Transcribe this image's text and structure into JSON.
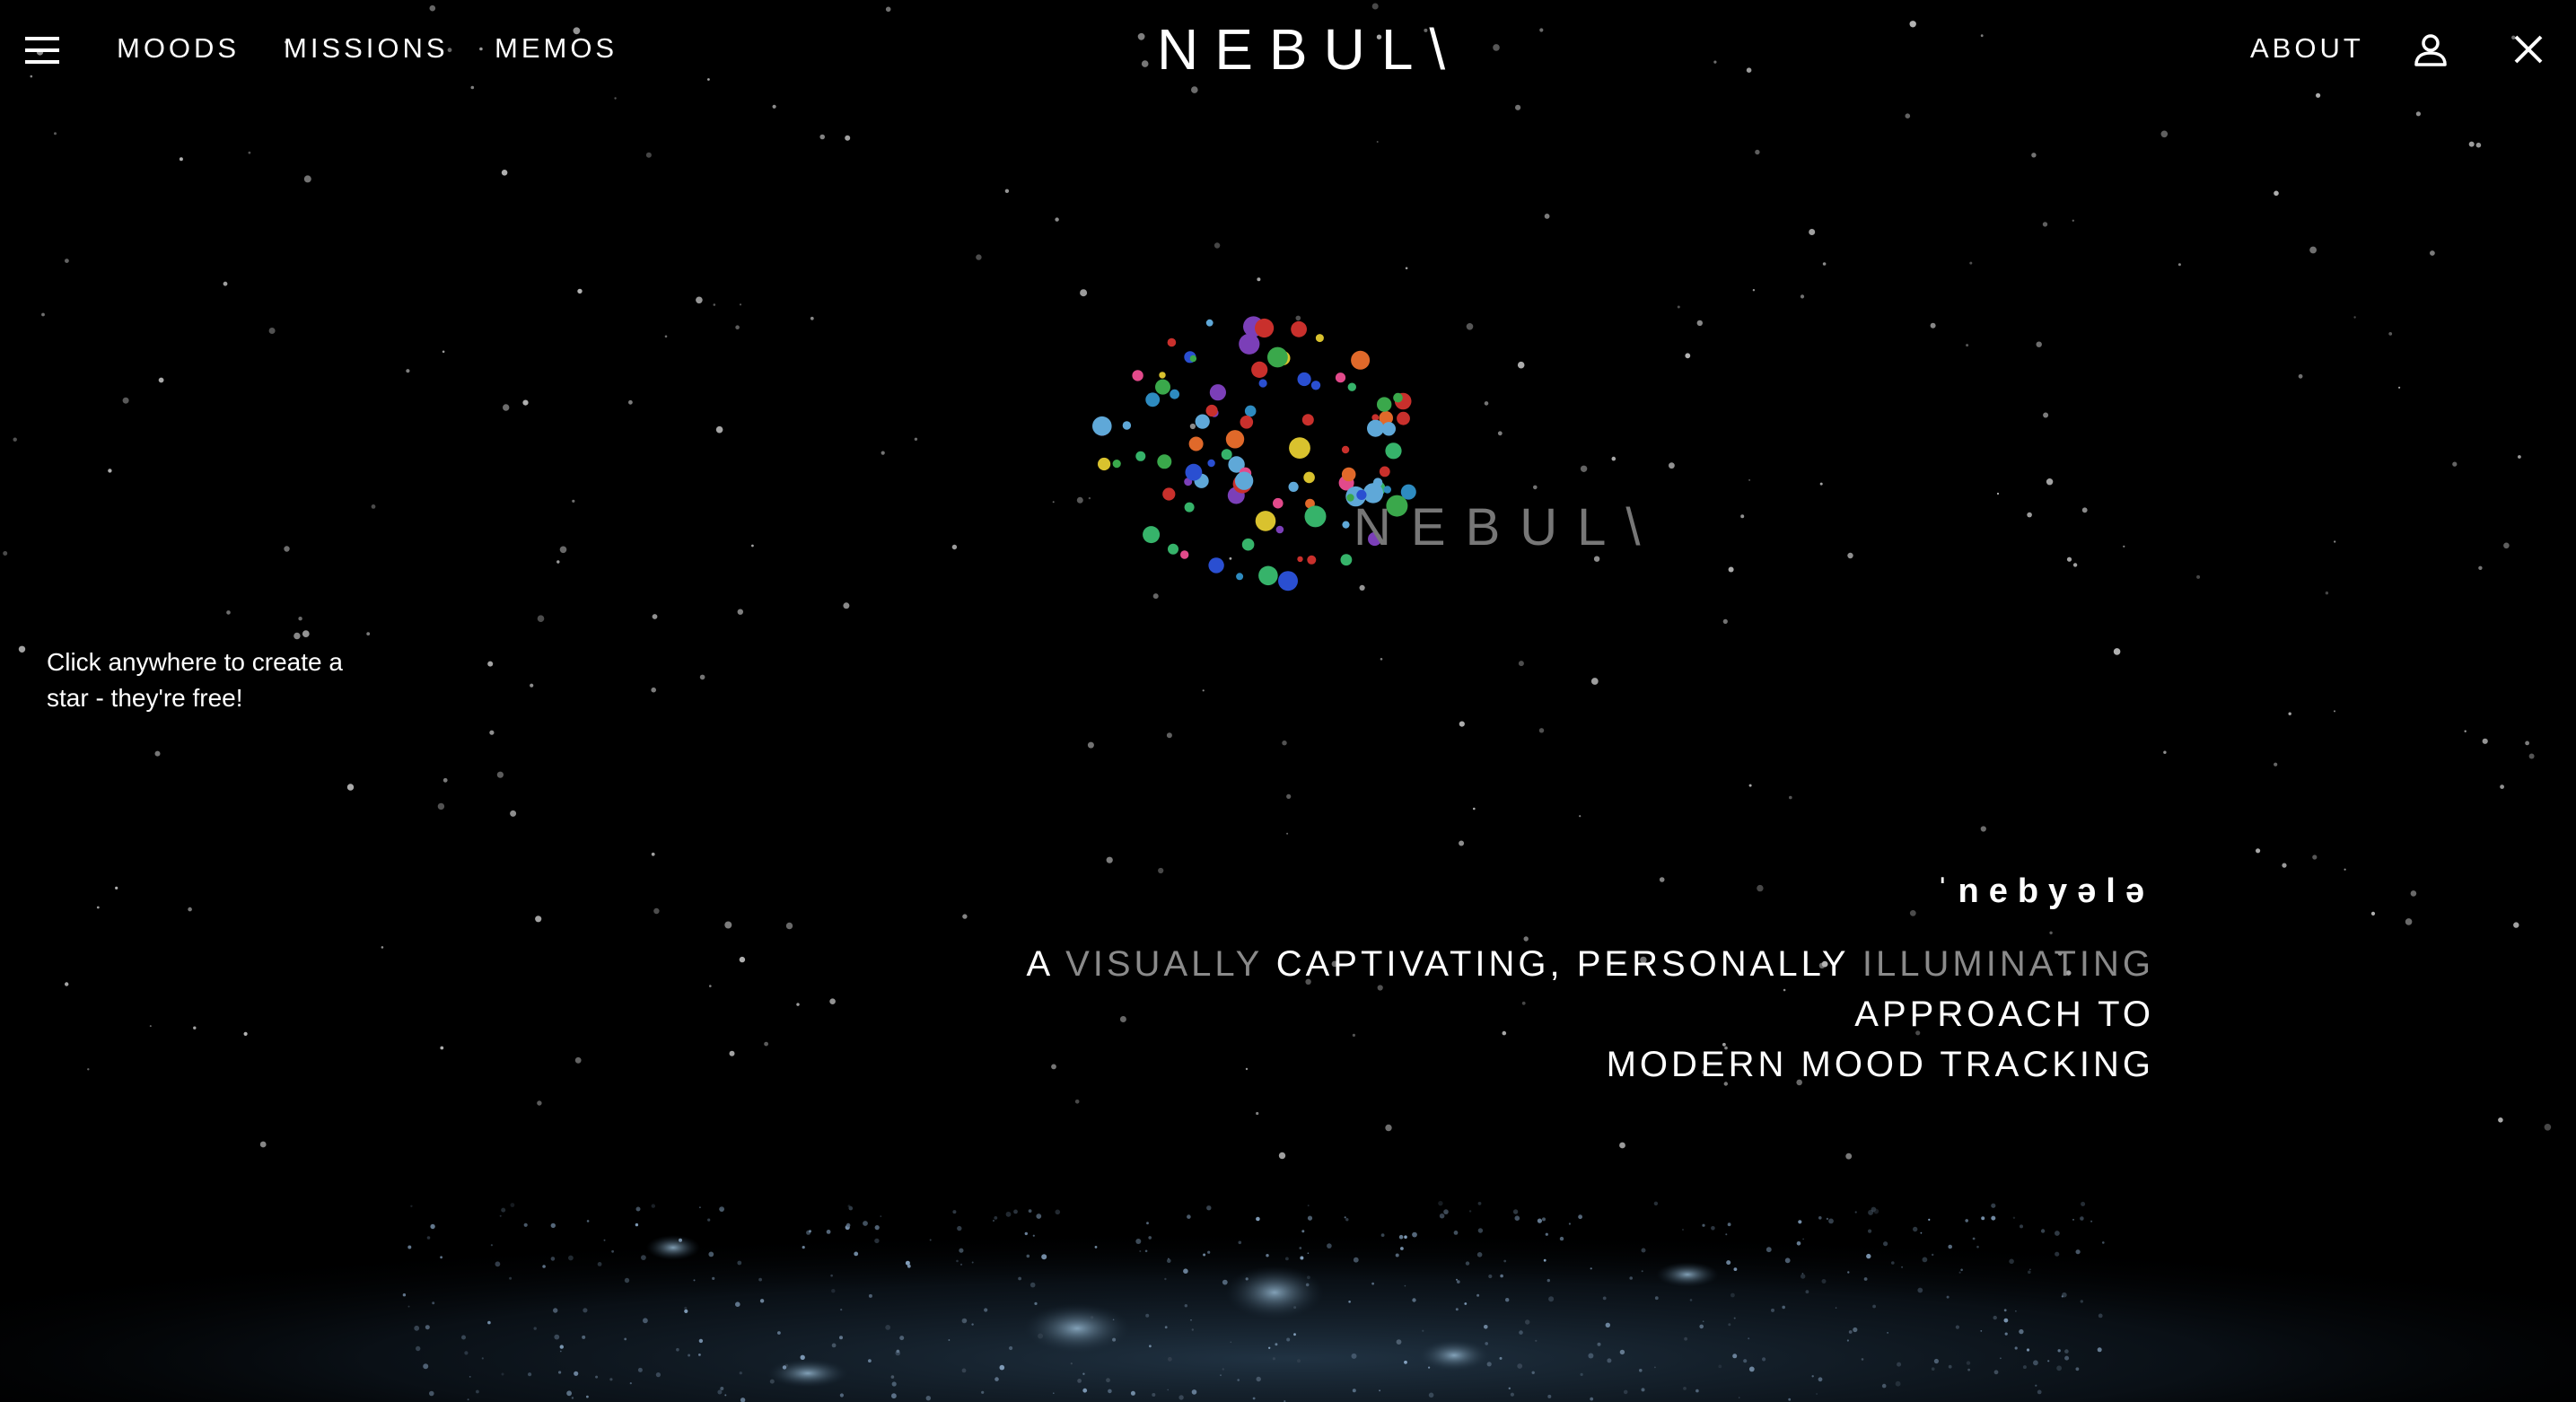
{
  "nav": {
    "menu_icon": "hamburger-menu-icon",
    "links": [
      "MOODS",
      "MISSIONS",
      "MEMOS"
    ],
    "brand": "NEBUL\\",
    "about": "ABOUT",
    "user_icon": "user-icon",
    "close_icon": "close-icon"
  },
  "hero": {
    "logo_word": "NEBUL\\",
    "phonetic": "ˈnebyələ",
    "tagline": {
      "part1": "A ",
      "word1": "VISUALLY",
      "part2": " CAPTIVATING, PERSONALLY ",
      "word2": "ILLUMINATING",
      "part3": " APPROACH TO",
      "line2": "MODERN MOOD TRACKING"
    }
  },
  "hint": {
    "text": "Click anywhere to create a star - they're free!"
  },
  "colors": {
    "background": "#000000",
    "text": "#ffffff",
    "dim_text": "#8a8a8a",
    "logo_text": "#777777"
  }
}
